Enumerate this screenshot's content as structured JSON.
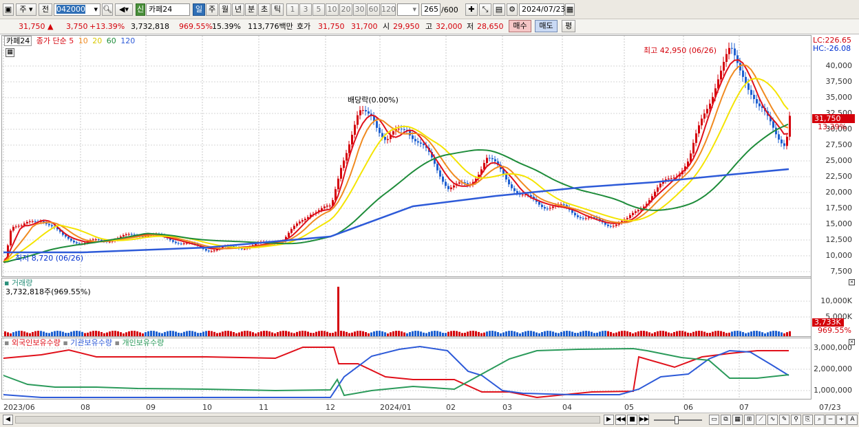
{
  "toolbar": {
    "period_label": "주",
    "prev_label": "전",
    "stock_code": "042000",
    "stock_badge": "신",
    "stock_name": "카페24",
    "periods": [
      "일",
      "주",
      "월",
      "년",
      "분",
      "초",
      "틱"
    ],
    "intervals": [
      "1",
      "3",
      "5",
      "10",
      "20",
      "30",
      "60",
      "120"
    ],
    "count": "265",
    "count_total": "/600",
    "date": "2024/07/23"
  },
  "quote": {
    "price": "31,750",
    "change": "3,750",
    "rate": "+13.39%",
    "volume": "3,732,818",
    "volume_ratio": "969.55%",
    "turnover": "15.39%",
    "amount": "113,776백만",
    "bid_label": "호가",
    "ask_price": "31,750",
    "bid_price": "31,700",
    "open_label": "시",
    "open": "29,950",
    "high_label": "고",
    "high": "32,000",
    "low_label": "저",
    "low": "28,650",
    "buy_label": "매수",
    "sell_label": "매도",
    "avg_label": "평"
  },
  "price_panel": {
    "title": "카페24",
    "ma_label": "종가 단순",
    "ma_periods": [
      "5",
      "10",
      "20",
      "60",
      "120"
    ],
    "lc": "LC:226.65",
    "hc": "HC:-26.08",
    "max_note": "최고 42,950 (06/26)",
    "min_note": "최저 8,720 (06/26)",
    "dividend_note": "배당락(0.00%)",
    "price_tag": "31,750",
    "rate_tag": "13.39%",
    "y_ticks": [
      "40,000",
      "37,500",
      "35,000",
      "32,500",
      "30,000",
      "27,500",
      "25,000",
      "22,500",
      "20,000",
      "17,500",
      "15,000",
      "12,500",
      "10,000",
      "7,500"
    ]
  },
  "volume_panel": {
    "title": "거래량",
    "value": "3,732,818주(969.55%)",
    "y_ticks": [
      "10,000K",
      "5,000K"
    ],
    "tag": "3,733K",
    "tag_pct": "969.55%"
  },
  "holding_panel": {
    "series": [
      "외국인보유수량",
      "기관보유수량",
      "개인보유수량"
    ],
    "y_ticks": [
      "3,000,000",
      "2,000,000",
      "1,000,000"
    ]
  },
  "x_axis": [
    "2023/06",
    "08",
    "09",
    "10",
    "11",
    "12",
    "2024/01",
    "02",
    "03",
    "04",
    "05",
    "06",
    "07",
    "07/23"
  ],
  "colors": {
    "up": "#d4000a",
    "down": "#1d5fd0",
    "ma5": "#e0101a",
    "ma10": "#f08a20",
    "ma20": "#f4e400",
    "ma60": "#1e8c3a",
    "ma120": "#2d5ad8",
    "foreign": "#e0101a",
    "institution": "#2d5ad8",
    "individual": "#2a9a5a"
  }
}
